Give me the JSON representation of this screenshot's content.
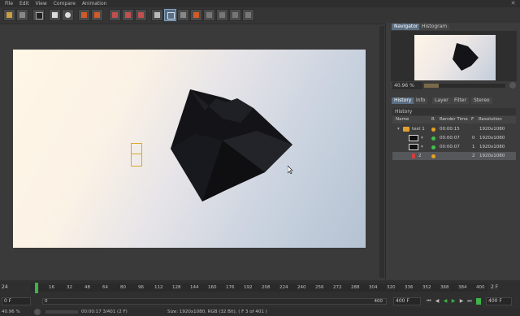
{
  "menu": [
    "File",
    "Edit",
    "View",
    "Compare",
    "Animation"
  ],
  "window_close": "✕",
  "toolbar_icons": [
    "open-icon",
    "save-icon",
    "film-icon",
    "render-region-icon",
    "render-view-icon",
    "render-icon",
    "picture-viewer-icon",
    "settings-icon",
    "compare-icon",
    "ab-icon",
    "split-icon",
    "a-icon",
    "b-icon",
    "channel-icon",
    "grid-icon",
    "layer-icon"
  ],
  "navigator": {
    "tabs": [
      "Navigator",
      "Histogram"
    ],
    "zoom": "40.96 %"
  },
  "info_tabs": [
    "History",
    "Info",
    "Layer",
    "Filter",
    "Stereo"
  ],
  "history": {
    "title": "History",
    "columns": [
      "Name",
      "R",
      "Render Time",
      "F",
      "Resolution"
    ],
    "rows": [
      {
        "name": "test 1",
        "time": "00:00:15",
        "frame": "",
        "res": "1920x1080",
        "status": "#e8a020"
      },
      {
        "name": "",
        "time": "00:00:07",
        "frame": "0",
        "res": "1920x1080",
        "status": "#3ec24a"
      },
      {
        "name": "",
        "time": "00:00:07",
        "frame": "1",
        "res": "1920x1080",
        "status": "#3ec24a"
      },
      {
        "name": "2",
        "time": "",
        "frame": "2",
        "res": "1920x1080",
        "status": "#e8a020"
      }
    ]
  },
  "timeline": {
    "start_frame": "24",
    "ticks": [
      "16",
      "32",
      "48",
      "64",
      "80",
      "96",
      "112",
      "128",
      "144",
      "160",
      "176",
      "192",
      "208",
      "224",
      "240",
      "256",
      "272",
      "288",
      "304",
      "320",
      "336",
      "352",
      "368",
      "384",
      "400"
    ],
    "current_frame": "2 F",
    "min_field": "0 F",
    "max_field": "400 F",
    "max_field2": "400 F",
    "range_start": "0",
    "range_end": "400"
  },
  "status": {
    "zoom": "40.96 %",
    "time": "00:00:17 3/401 (2 F)",
    "info": "Size: 1920x1080, RGB (32 Bit),  ( F 3 of 401 )"
  },
  "colors": {
    "accent": "#5a6d82",
    "ok": "#3ec24a",
    "pending": "#e8a020",
    "playhead": "#3fb24a"
  }
}
